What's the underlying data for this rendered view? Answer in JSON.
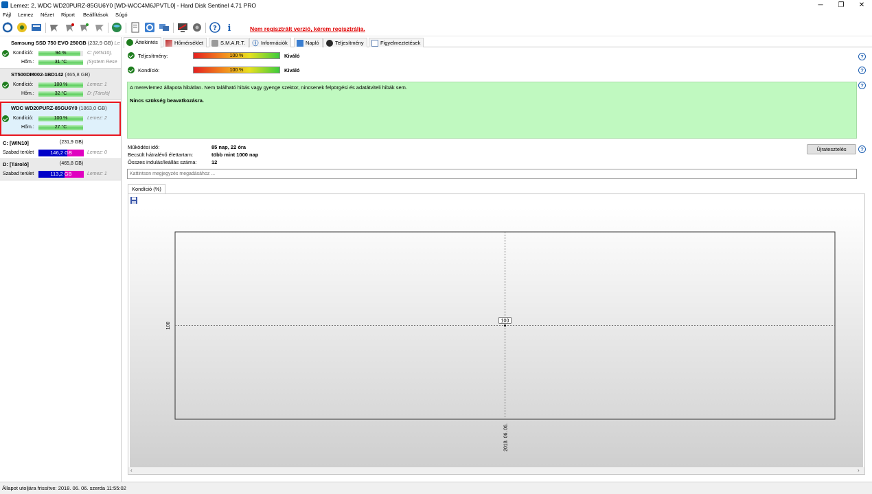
{
  "window": {
    "title": "Lemez: 2, WDC WD20PURZ-85GU6Y0 [WD-WCC4M6JPVTL0]  -  Hard Disk Sentinel 4.71 PRO",
    "minimize": "─",
    "restore": "❐",
    "close": "✕"
  },
  "menu": [
    "Fájl",
    "Lemez",
    "Nézet",
    "Riport",
    "Beállítások",
    "Súgó"
  ],
  "toolbar": {
    "register_text": "Nem regisztrált verzió, kérem regisztrálja."
  },
  "disks": [
    {
      "name": "Samsung SSD 750 EVO 250GB",
      "size": "(232,9 GB)",
      "extra": "Le",
      "condition_label": "Kondíció:",
      "condition": "94 %",
      "condition_pct": 94,
      "temp_label": "Hőm.:",
      "temp": "31 °C",
      "temp_pct": 100,
      "side1": "C: [WIN10],",
      "side2": "[System Rese"
    },
    {
      "name": "ST500DM002-1BD142",
      "size": "(465,8 GB)",
      "condition_label": "Kondíció:",
      "condition": "100 %",
      "condition_pct": 100,
      "temp_label": "Hőm.:",
      "temp": "32 °C",
      "temp_pct": 100,
      "side1": "Lemez: 1",
      "side2": "D: [Tároló]"
    },
    {
      "name": "WDC WD20PURZ-85GU6Y0",
      "size": "(1863,0 GB)",
      "condition_label": "Kondíció:",
      "condition": "100 %",
      "condition_pct": 100,
      "temp_label": "Hőm.:",
      "temp": "27 °C",
      "temp_pct": 100,
      "side1": "Lemez: 2",
      "side2": ""
    }
  ],
  "volumes": [
    {
      "name": "C: [WIN10]",
      "size": "(231,9 GB)",
      "free_label": "Szabad terület",
      "free": "146,2 GB",
      "free_pct": 63,
      "side": "Lemez: 0"
    },
    {
      "name": "D: [Tároló]",
      "size": "(465,8 GB)",
      "free_label": "Szabad terület",
      "free": "113,2 GB",
      "free_pct": 57,
      "side": "Lemez: 1"
    }
  ],
  "tabs": [
    "Áttekintés",
    "Hőmérséklet",
    "S.M.A.R.T.",
    "Információk",
    "Napló",
    "Teljesítmény",
    "Figyelmeztetések"
  ],
  "overview": {
    "performance_label": "Teljesítmény:",
    "performance": "100 %",
    "performance_rating": "Kiváló",
    "condition_label": "Kondíció:",
    "condition": "100 %",
    "condition_rating": "Kiváló",
    "status_text": "A merevlemez állapota hibátlan. Nem található hibás vagy gyenge szektor, nincsenek felpörgési és adatátviteli hibák sem.",
    "action_text": "Nincs szükség beavatkozásra.",
    "uptime_label": "Működési idő:",
    "uptime": "85 nap, 22 óra",
    "lifetime_label": "Becsült hátralévő élettartam:",
    "lifetime": "több mint 1000 nap",
    "startstop_label": "Összes indulás/leállás száma:",
    "startstop": "12",
    "retest_button": "Újratesztelés",
    "note_placeholder": "Kattintson megjegyzés megadásához ...",
    "chart_tab": "Kondíció  (%)"
  },
  "colors": {
    "ok_green": "#1e7d1e",
    "status_bg": "#c0f9c0",
    "register_red": "#e00000",
    "space_blue": "#0000c8",
    "space_magenta": "#e000c0"
  },
  "chart_data": {
    "type": "line",
    "x": [
      "2018. 06. 06."
    ],
    "series": [
      {
        "values": [
          100
        ]
      }
    ],
    "ylabel_ticks": [
      "100"
    ],
    "data_labels": [
      "100"
    ],
    "grid": true
  },
  "status_bar": "Állapot utoljára frissítve: 2018. 06. 06. szerda 11:55:02"
}
